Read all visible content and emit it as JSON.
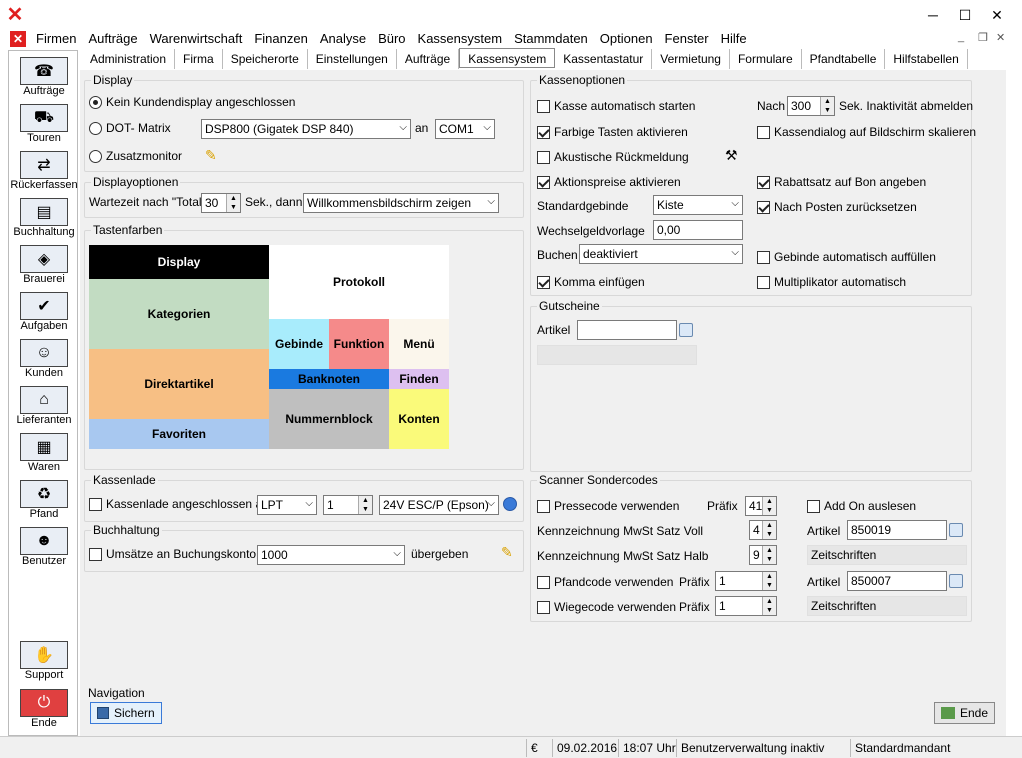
{
  "app": {
    "icon": "app-x-icon"
  },
  "window": {
    "min": "─",
    "max": "☐",
    "close": "✕",
    "mdi_min": "_",
    "mdi_restore": "❐",
    "mdi_close": "✕"
  },
  "menu": [
    "Firmen",
    "Aufträge",
    "Warenwirtschaft",
    "Finanzen",
    "Analyse",
    "Büro",
    "Kassensystem",
    "Stammdaten",
    "Optionen",
    "Fenster",
    "Hilfe"
  ],
  "tabs": [
    "Administration",
    "Firma",
    "Speicherorte",
    "Einstellungen",
    "Aufträge",
    "Kassensystem",
    "Kassentastatur",
    "Vermietung",
    "Formulare",
    "Pfandtabelle",
    "Hilfstabellen"
  ],
  "active_tab": "Kassensystem",
  "sidebar": [
    {
      "label": "Aufträge",
      "icon": "headset-icon"
    },
    {
      "label": "Touren",
      "icon": "truck-icon"
    },
    {
      "label": "Rückerfassen",
      "icon": "truck-return-icon"
    },
    {
      "label": "Buchhaltung",
      "icon": "ledger-icon"
    },
    {
      "label": "Brauerei",
      "icon": "brewery-icon"
    },
    {
      "label": "Aufgaben",
      "icon": "tasks-icon"
    },
    {
      "label": "Kunden",
      "icon": "customers-icon"
    },
    {
      "label": "Lieferanten",
      "icon": "suppliers-icon"
    },
    {
      "label": "Waren",
      "icon": "goods-icon"
    },
    {
      "label": "Pfand",
      "icon": "deposit-icon"
    },
    {
      "label": "Benutzer",
      "icon": "user-icon"
    },
    {
      "label": "Support",
      "icon": "handshake-icon"
    },
    {
      "label": "Ende",
      "icon": "power-icon"
    }
  ],
  "display": {
    "title": "Display",
    "opt1": "Kein Kundendisplay angeschlossen",
    "opt2": "DOT- Matrix",
    "opt3": "Zusatzmonitor",
    "device": "DSP800 (Gigatek DSP 840)",
    "an": "an",
    "port": "COM1"
  },
  "displayoptionen": {
    "title": "Displayoptionen",
    "label": "Wartezeit nach \"Total\"",
    "seconds": "30",
    "dann": "Sek., dann",
    "action": "Willkommensbildschirm zeigen"
  },
  "tastenfarben": {
    "title": "Tastenfarben",
    "tiles": {
      "display": "Display",
      "protokoll": "Protokoll",
      "kategorien": "Kategorien",
      "gebinde": "Gebinde",
      "funktion": "Funktion",
      "menu": "Menü",
      "direktartikel": "Direktartikel",
      "banknoten": "Banknoten",
      "finden": "Finden",
      "nummernblock": "Nummernblock",
      "konten": "Konten",
      "favoriten": "Favoriten"
    },
    "colors": {
      "display": "#000000",
      "kategorien": "#c2dcc2",
      "direktartikel": "#f7bf84",
      "favoriten": "#a8c8f0",
      "gebinde": "#a8ecfc",
      "funktion": "#f58a8a",
      "menu": "#fbf6ec",
      "banknoten": "#1a7ae0",
      "finden": "#ddc0f0",
      "nummernblock": "#bfbfbf",
      "konten": "#fafa7a"
    }
  },
  "kassenlade": {
    "title": "Kassenlade",
    "label": "Kassenlade angeschlossen an",
    "port": "LPT",
    "num": "1",
    "printer": "24V ESC/P (Epson)"
  },
  "buchhaltung": {
    "title": "Buchhaltung",
    "label": "Umsätze an Buchungskonto",
    "account": "1000",
    "btn": "übergeben"
  },
  "kassenoptionen": {
    "title": "Kassenoptionen",
    "autostart": "Kasse automatisch starten",
    "nach": "Nach",
    "nach_val": "300",
    "inakt": "Sek. Inaktivität abmelden",
    "farbig": "Farbige Tasten aktivieren",
    "skal": "Kassendialog auf Bildschirm skalieren",
    "akust": "Akustische Rückmeldung",
    "aktion": "Aktionspreise aktivieren",
    "rabatt": "Rabattsatz auf Bon angeben",
    "std_label": "Standardgebinde",
    "std_val": "Kiste",
    "nachposten": "Nach Posten zurücksetzen",
    "wechsel_label": "Wechselgeldvorlage",
    "wechsel_val": "0,00",
    "buchen_label": "Buchen",
    "buchen_val": "deaktiviert",
    "gebindeauto": "Gebinde automatisch auffüllen",
    "komma": "Komma einfügen",
    "multi": "Multiplikator automatisch"
  },
  "gutscheine": {
    "title": "Gutscheine",
    "artikel": "Artikel",
    "artikel_val": ""
  },
  "scanner": {
    "title": "Scanner Sondercodes",
    "presse": "Pressecode verwenden",
    "praefix": "Präfix",
    "presse_val": "41",
    "addon": "Add On auslesen",
    "voll_label": "Kennzeichnung MwSt Satz Voll",
    "voll_val": "4",
    "artikel": "Artikel",
    "voll_artikel": "850019",
    "halb_label": "Kennzeichnung MwSt Satz Halb",
    "halb_val": "9",
    "halb_desc": "Zeitschriften",
    "pfand": "Pfandcode verwenden",
    "pfand_val": "1",
    "pfand_artikel": "850007",
    "wiege": "Wiegecode verwenden",
    "wiege_val": "1",
    "wiege_desc": "Zeitschriften"
  },
  "navigation": {
    "title": "Navigation",
    "save": "Sichern",
    "end": "Ende"
  },
  "status": {
    "currency": "€",
    "date": "09.02.2016",
    "time": "18:07 Uhr",
    "user": "Benutzerverwaltung inaktiv",
    "client": "Standardmandant"
  }
}
